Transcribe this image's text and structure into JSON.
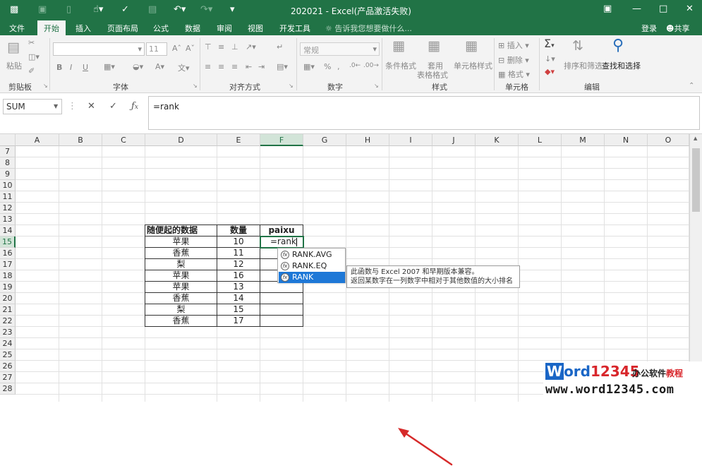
{
  "window": {
    "title": "202021 - Excel(产品激活失败)",
    "login": "登录",
    "share": "共享"
  },
  "tabs": [
    "文件",
    "开始",
    "插入",
    "页面布局",
    "公式",
    "数据",
    "审阅",
    "视图",
    "开发工具"
  ],
  "active_tab": "开始",
  "tell_me": "告诉我您想要做什么...",
  "ribbon": {
    "clipboard": {
      "paste": "粘贴",
      "label": "剪贴板"
    },
    "font": {
      "label": "字体",
      "size": "11",
      "controls": [
        "B",
        "I",
        "U"
      ]
    },
    "alignment": {
      "label": "对齐方式"
    },
    "number": {
      "label": "数字",
      "format": "常规"
    },
    "styles": {
      "label": "样式",
      "conditional": "条件格式",
      "table1": "套用",
      "table2": "表格格式",
      "cell_styles": "单元格样式"
    },
    "cells": {
      "label": "单元格",
      "insert": "插入",
      "delete": "删除",
      "format": "格式"
    },
    "editing": {
      "label": "编辑",
      "sort": "排序和筛选",
      "find": "查找和选择"
    }
  },
  "formula_bar": {
    "name_box": "SUM",
    "formula": "=rank"
  },
  "columns": [
    "A",
    "B",
    "C",
    "D",
    "E",
    "F",
    "G",
    "H",
    "I",
    "J",
    "K",
    "L",
    "M",
    "N",
    "O"
  ],
  "selected_column": "F",
  "rows": [
    7,
    8,
    9,
    10,
    11,
    12,
    13,
    14,
    15,
    16,
    17,
    18,
    19,
    20,
    21,
    22,
    23,
    24,
    25,
    26,
    27,
    28
  ],
  "selected_row": 15,
  "table": {
    "headers": [
      "随便起的数据",
      "数量",
      "paixu"
    ],
    "rows": [
      [
        "苹果",
        "10",
        "=rank"
      ],
      [
        "香蕉",
        "11",
        ""
      ],
      [
        "梨",
        "12",
        ""
      ],
      [
        "苹果",
        "16",
        ""
      ],
      [
        "苹果",
        "13",
        ""
      ],
      [
        "香蕉",
        "14",
        ""
      ],
      [
        "梨",
        "15",
        ""
      ],
      [
        "香蕉",
        "17",
        ""
      ]
    ]
  },
  "autocomplete": {
    "items": [
      "RANK.AVG",
      "RANK.EQ",
      "RANK"
    ],
    "highlighted": "RANK",
    "tooltip": [
      "此函数与 Excel 2007 和早期版本兼容。",
      "返回某数字在一列数字中相对于其他数值的大小排名"
    ]
  },
  "watermark": {
    "brand_w": "W",
    "brand_ord": "ord",
    "brand_num": "12345",
    "tag_black": "办公软件",
    "tag_red": "教程",
    "url": "www.word12345.com"
  }
}
